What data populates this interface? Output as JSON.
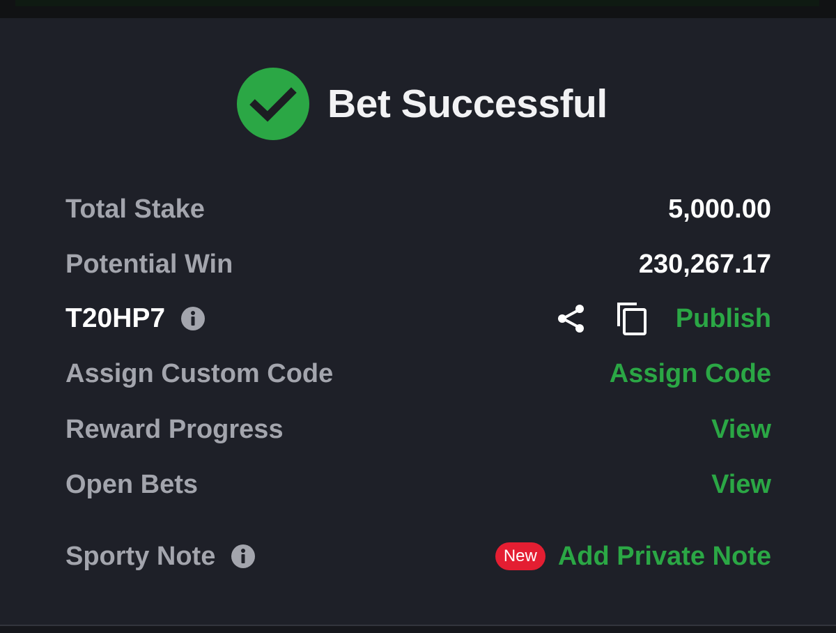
{
  "header": {
    "title": "Bet Successful",
    "status_icon": "check-circle-icon",
    "accent_color": "#2ba745"
  },
  "rows": {
    "total_stake": {
      "label": "Total Stake",
      "value": "5,000.00"
    },
    "potential_win": {
      "label": "Potential Win",
      "value": "230,267.17"
    },
    "booking_code": {
      "code": "T20HP7",
      "info_icon": "info-icon",
      "share_icon": "share-icon",
      "copy_icon": "copy-icon",
      "publish_label": "Publish"
    },
    "custom_code": {
      "label": "Assign Custom Code",
      "action": "Assign Code"
    },
    "reward_progress": {
      "label": "Reward Progress",
      "action": "View"
    },
    "open_bets": {
      "label": "Open Bets",
      "action": "View"
    },
    "sporty_note": {
      "label": "Sporty Note",
      "info_icon": "info-icon",
      "badge": "New",
      "action": "Add Private Note"
    }
  },
  "colors": {
    "background": "#1e2028",
    "label": "#a3a5ad",
    "value": "#ffffff",
    "link": "#2ba745",
    "badge": "#e41e32"
  }
}
